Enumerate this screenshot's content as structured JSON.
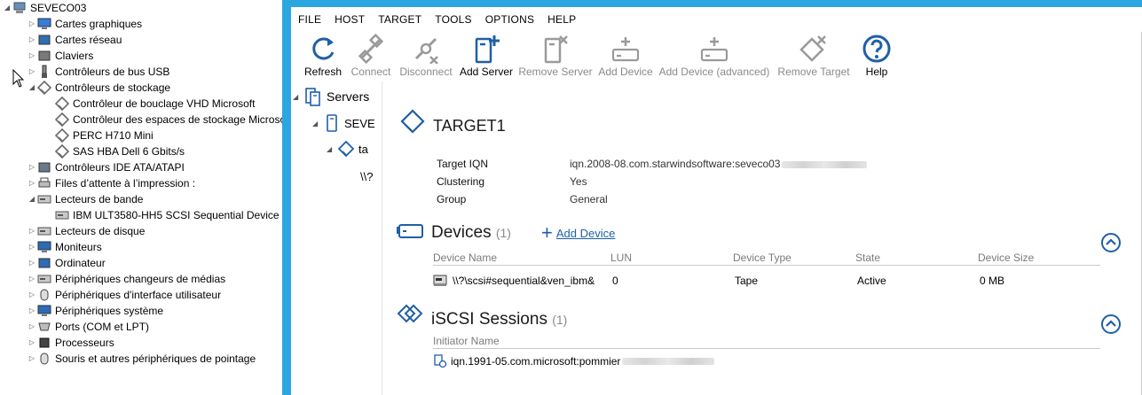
{
  "device_manager": {
    "root": "SEVECO03",
    "items": [
      {
        "label": "Cartes graphiques",
        "icon": "display-adapter-icon",
        "depth": 1,
        "expanded": false
      },
      {
        "label": "Cartes réseau",
        "icon": "network-adapter-icon",
        "depth": 1,
        "expanded": false
      },
      {
        "label": "Claviers",
        "icon": "keyboard-icon",
        "depth": 1,
        "expanded": false
      },
      {
        "label": "Contrôleurs de bus USB",
        "icon": "usb-icon",
        "depth": 1,
        "expanded": false
      },
      {
        "label": "Contrôleurs de stockage",
        "icon": "storage-controller-icon",
        "depth": 1,
        "expanded": true
      },
      {
        "label": "Contrôleur de bouclage VHD Microsoft",
        "icon": "storage-controller-icon",
        "depth": 2
      },
      {
        "label": "Contrôleur des espaces de stockage Microso",
        "icon": "storage-controller-icon",
        "depth": 2
      },
      {
        "label": "PERC H710 Mini",
        "icon": "storage-controller-icon",
        "depth": 2
      },
      {
        "label": "SAS HBA Dell 6 Gbits/s",
        "icon": "storage-controller-icon",
        "depth": 2
      },
      {
        "label": "Contrôleurs IDE ATA/ATAPI",
        "icon": "ide-controller-icon",
        "depth": 1,
        "expanded": false
      },
      {
        "label": "Files d’attente à l’impression :",
        "icon": "printer-icon",
        "depth": 1,
        "expanded": false
      },
      {
        "label": "Lecteurs de bande",
        "icon": "tape-drive-icon",
        "depth": 1,
        "expanded": true
      },
      {
        "label": "IBM ULT3580-HH5 SCSI Sequential Device",
        "icon": "tape-drive-icon",
        "depth": 2
      },
      {
        "label": "Lecteurs de disque",
        "icon": "disk-drive-icon",
        "depth": 1,
        "expanded": false
      },
      {
        "label": "Moniteurs",
        "icon": "monitor-icon",
        "depth": 1,
        "expanded": false
      },
      {
        "label": "Ordinateur",
        "icon": "computer-icon",
        "depth": 1,
        "expanded": false
      },
      {
        "label": "Périphériques changeurs de médias",
        "icon": "media-changer-icon",
        "depth": 1,
        "expanded": false
      },
      {
        "label": "Périphériques d'interface utilisateur",
        "icon": "hid-icon",
        "depth": 1,
        "expanded": false
      },
      {
        "label": "Périphériques système",
        "icon": "system-device-icon",
        "depth": 1,
        "expanded": false
      },
      {
        "label": "Ports (COM et LPT)",
        "icon": "port-icon",
        "depth": 1,
        "expanded": false
      },
      {
        "label": "Processeurs",
        "icon": "processor-icon",
        "depth": 1,
        "expanded": false
      },
      {
        "label": "Souris et autres périphériques de pointage",
        "icon": "mouse-icon",
        "depth": 1,
        "expanded": false
      }
    ]
  },
  "starwind": {
    "accent": "#2ca6e0",
    "icon_blue": "#1f5fa8",
    "menu": [
      "FILE",
      "HOST",
      "TARGET",
      "TOOLS",
      "OPTIONS",
      "HELP"
    ],
    "toolbar": [
      {
        "label": "Refresh",
        "icon": "refresh-icon",
        "enabled": true
      },
      {
        "label": "Connect",
        "icon": "connect-icon",
        "enabled": false
      },
      {
        "label": "Disconnect",
        "icon": "disconnect-icon",
        "enabled": false
      },
      {
        "label": "Add Server",
        "icon": "add-server-icon",
        "enabled": true
      },
      {
        "label": "Remove Server",
        "icon": "remove-server-icon",
        "enabled": false
      },
      {
        "label": "Add Device",
        "icon": "add-device-icon",
        "enabled": false
      },
      {
        "label": "Add Device (advanced)",
        "icon": "add-device-advanced-icon",
        "enabled": false
      },
      {
        "label": "Remove Target",
        "icon": "remove-target-icon",
        "enabled": false
      },
      {
        "label": "Help",
        "icon": "help-icon",
        "enabled": true
      }
    ],
    "nav": {
      "servers": "Servers",
      "server": "SEVE",
      "target": "ta",
      "device": "\\\\?"
    },
    "target": {
      "name": "TARGET1",
      "iqn_label": "Target IQN",
      "iqn_value": "iqn.2008-08.com.starwindsoftware:seveco03",
      "clustering_label": "Clustering",
      "clustering_value": "Yes",
      "group_label": "Group",
      "group_value": "General"
    },
    "devices": {
      "title": "Devices",
      "count": "(1)",
      "add_link": "Add Device",
      "columns": [
        "Device Name",
        "LUN",
        "Device Type",
        "State",
        "Device Size"
      ],
      "rows": [
        {
          "name": "\\\\?\\scsi#sequential&ven_ibm&",
          "lun": "0",
          "type": "Tape",
          "state": "Active",
          "size": "0 MB"
        }
      ]
    },
    "sessions": {
      "title": "iSCSI Sessions",
      "count": "(1)",
      "column": "Initiator Name",
      "rows": [
        {
          "initiator": "iqn.1991-05.com.microsoft:pommier"
        }
      ]
    }
  }
}
